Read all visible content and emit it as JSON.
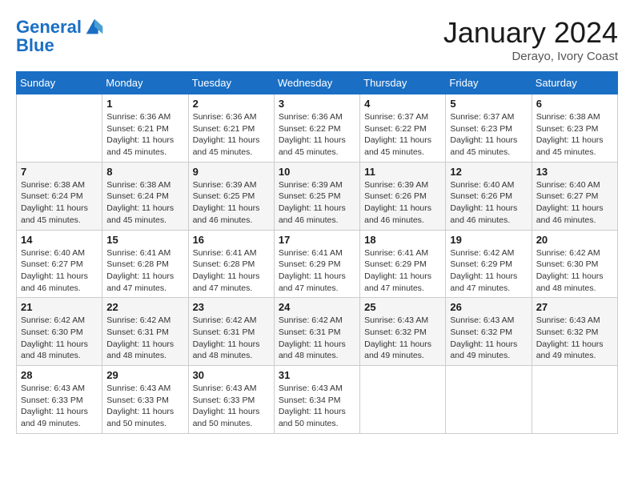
{
  "header": {
    "logo_line1": "General",
    "logo_line2": "Blue",
    "month": "January 2024",
    "location": "Derayo, Ivory Coast"
  },
  "weekdays": [
    "Sunday",
    "Monday",
    "Tuesday",
    "Wednesday",
    "Thursday",
    "Friday",
    "Saturday"
  ],
  "weeks": [
    [
      {
        "day": "",
        "info": ""
      },
      {
        "day": "1",
        "info": "Sunrise: 6:36 AM\nSunset: 6:21 PM\nDaylight: 11 hours and 45 minutes."
      },
      {
        "day": "2",
        "info": "Sunrise: 6:36 AM\nSunset: 6:21 PM\nDaylight: 11 hours and 45 minutes."
      },
      {
        "day": "3",
        "info": "Sunrise: 6:36 AM\nSunset: 6:22 PM\nDaylight: 11 hours and 45 minutes."
      },
      {
        "day": "4",
        "info": "Sunrise: 6:37 AM\nSunset: 6:22 PM\nDaylight: 11 hours and 45 minutes."
      },
      {
        "day": "5",
        "info": "Sunrise: 6:37 AM\nSunset: 6:23 PM\nDaylight: 11 hours and 45 minutes."
      },
      {
        "day": "6",
        "info": "Sunrise: 6:38 AM\nSunset: 6:23 PM\nDaylight: 11 hours and 45 minutes."
      }
    ],
    [
      {
        "day": "7",
        "info": "Sunrise: 6:38 AM\nSunset: 6:24 PM\nDaylight: 11 hours and 45 minutes."
      },
      {
        "day": "8",
        "info": "Sunrise: 6:38 AM\nSunset: 6:24 PM\nDaylight: 11 hours and 45 minutes."
      },
      {
        "day": "9",
        "info": "Sunrise: 6:39 AM\nSunset: 6:25 PM\nDaylight: 11 hours and 46 minutes."
      },
      {
        "day": "10",
        "info": "Sunrise: 6:39 AM\nSunset: 6:25 PM\nDaylight: 11 hours and 46 minutes."
      },
      {
        "day": "11",
        "info": "Sunrise: 6:39 AM\nSunset: 6:26 PM\nDaylight: 11 hours and 46 minutes."
      },
      {
        "day": "12",
        "info": "Sunrise: 6:40 AM\nSunset: 6:26 PM\nDaylight: 11 hours and 46 minutes."
      },
      {
        "day": "13",
        "info": "Sunrise: 6:40 AM\nSunset: 6:27 PM\nDaylight: 11 hours and 46 minutes."
      }
    ],
    [
      {
        "day": "14",
        "info": "Sunrise: 6:40 AM\nSunset: 6:27 PM\nDaylight: 11 hours and 46 minutes."
      },
      {
        "day": "15",
        "info": "Sunrise: 6:41 AM\nSunset: 6:28 PM\nDaylight: 11 hours and 47 minutes."
      },
      {
        "day": "16",
        "info": "Sunrise: 6:41 AM\nSunset: 6:28 PM\nDaylight: 11 hours and 47 minutes."
      },
      {
        "day": "17",
        "info": "Sunrise: 6:41 AM\nSunset: 6:29 PM\nDaylight: 11 hours and 47 minutes."
      },
      {
        "day": "18",
        "info": "Sunrise: 6:41 AM\nSunset: 6:29 PM\nDaylight: 11 hours and 47 minutes."
      },
      {
        "day": "19",
        "info": "Sunrise: 6:42 AM\nSunset: 6:29 PM\nDaylight: 11 hours and 47 minutes."
      },
      {
        "day": "20",
        "info": "Sunrise: 6:42 AM\nSunset: 6:30 PM\nDaylight: 11 hours and 48 minutes."
      }
    ],
    [
      {
        "day": "21",
        "info": "Sunrise: 6:42 AM\nSunset: 6:30 PM\nDaylight: 11 hours and 48 minutes."
      },
      {
        "day": "22",
        "info": "Sunrise: 6:42 AM\nSunset: 6:31 PM\nDaylight: 11 hours and 48 minutes."
      },
      {
        "day": "23",
        "info": "Sunrise: 6:42 AM\nSunset: 6:31 PM\nDaylight: 11 hours and 48 minutes."
      },
      {
        "day": "24",
        "info": "Sunrise: 6:42 AM\nSunset: 6:31 PM\nDaylight: 11 hours and 48 minutes."
      },
      {
        "day": "25",
        "info": "Sunrise: 6:43 AM\nSunset: 6:32 PM\nDaylight: 11 hours and 49 minutes."
      },
      {
        "day": "26",
        "info": "Sunrise: 6:43 AM\nSunset: 6:32 PM\nDaylight: 11 hours and 49 minutes."
      },
      {
        "day": "27",
        "info": "Sunrise: 6:43 AM\nSunset: 6:32 PM\nDaylight: 11 hours and 49 minutes."
      }
    ],
    [
      {
        "day": "28",
        "info": "Sunrise: 6:43 AM\nSunset: 6:33 PM\nDaylight: 11 hours and 49 minutes."
      },
      {
        "day": "29",
        "info": "Sunrise: 6:43 AM\nSunset: 6:33 PM\nDaylight: 11 hours and 50 minutes."
      },
      {
        "day": "30",
        "info": "Sunrise: 6:43 AM\nSunset: 6:33 PM\nDaylight: 11 hours and 50 minutes."
      },
      {
        "day": "31",
        "info": "Sunrise: 6:43 AM\nSunset: 6:34 PM\nDaylight: 11 hours and 50 minutes."
      },
      {
        "day": "",
        "info": ""
      },
      {
        "day": "",
        "info": ""
      },
      {
        "day": "",
        "info": ""
      }
    ]
  ]
}
